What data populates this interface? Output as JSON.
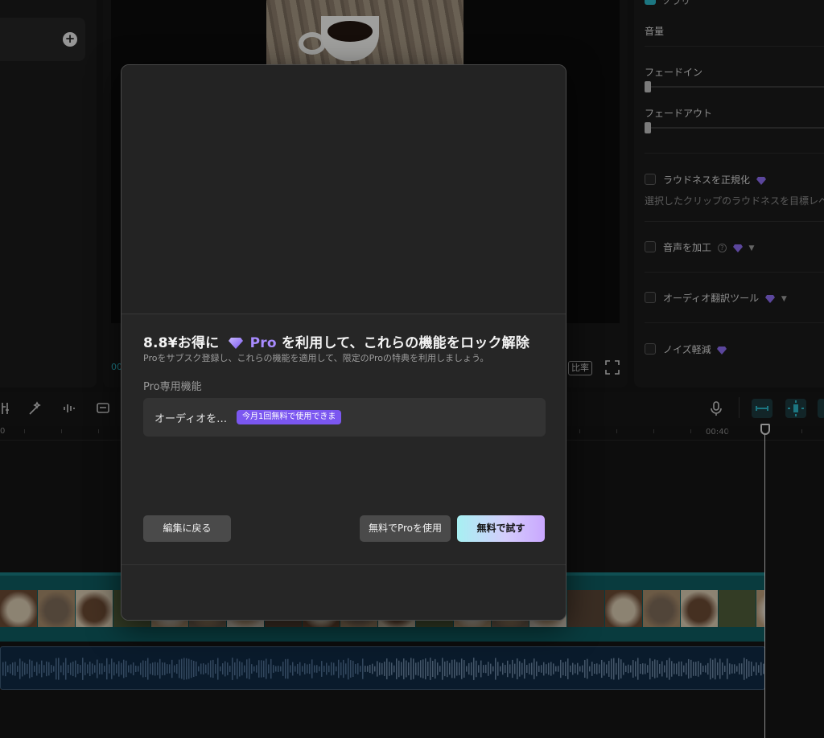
{
  "editor": {
    "left_add_icon": "plus-icon",
    "preview": {
      "timecode_fragment": "00",
      "ratio_label": "比率",
      "fullscreen_icon": "fullscreen-icon"
    },
    "properties": {
      "top_label_fragment": "ソラリ",
      "volume_label": "音量",
      "fade_in_label": "フェードイン",
      "fade_out_label": "フェードアウト",
      "loudness_label": "ラウドネスを正規化",
      "loudness_desc": "選択したクリップのラウドネスを目標レベル",
      "voice_effect_label": "音声を加工",
      "audio_translate_label": "オーディオ翻訳ツール",
      "noise_reduce_label": "ノイズ軽減"
    },
    "timeline": {
      "ruler_time": "00:40",
      "ruler_start": "0"
    }
  },
  "modal": {
    "title_prefix": "8.8¥お得に",
    "title_pro": "Pro",
    "title_suffix": "を利用して、これらの機能をロック解除",
    "subtitle": "Proをサブスク登録し、これらの機能を適用して、限定のProの特典を利用しましょう。",
    "section_title": "Pro専用機能",
    "feature": {
      "name": "オーディオを…",
      "badge": "今月1回無料で使用できま"
    },
    "buttons": {
      "back": "編集に戻る",
      "use_pro_free": "無料でProを使用",
      "try_free": "無料で試す"
    }
  },
  "colors": {
    "accent": "#2bb6c7",
    "pro_purple": "#a88bff",
    "badge": "#7b57f0"
  }
}
